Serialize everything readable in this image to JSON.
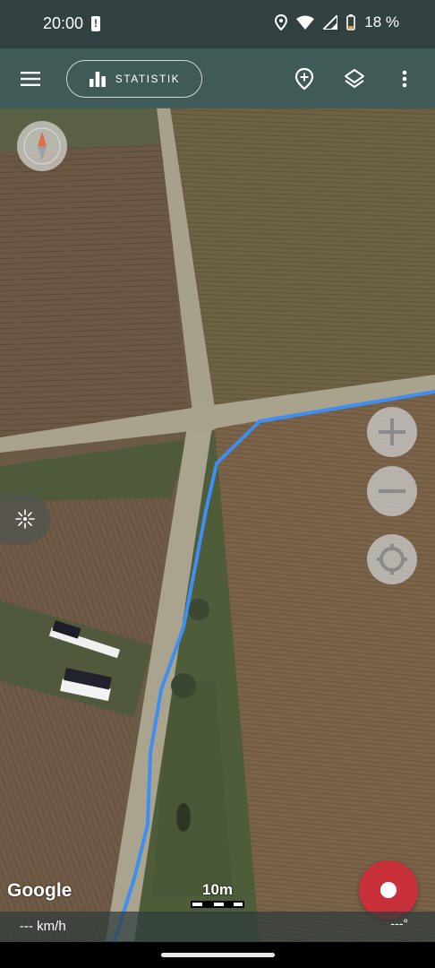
{
  "status_bar": {
    "time": "20:00",
    "alert_glyph": "!",
    "battery_text": "18 %",
    "icons": [
      "location-icon",
      "wifi-icon",
      "signal-icon",
      "battery-icon"
    ]
  },
  "toolbar": {
    "menu_icon": "menu-icon",
    "stat_label": "STATISTIK",
    "stat_icon": "bar-chart-icon",
    "add_marker_icon": "add-location-icon",
    "layers_icon": "layers-icon",
    "overflow_icon": "more-vert-icon"
  },
  "map": {
    "attribution": "Google",
    "scale_label": "10m",
    "track_color": "#3f8ef2"
  },
  "controls": {
    "zoom_in": "plus-icon",
    "zoom_out": "minus-icon",
    "locate": "my-location-icon",
    "compass": "compass-icon",
    "side_tab": "sun-icon"
  },
  "bottom": {
    "speed": "--- km/h",
    "heading": "---°"
  },
  "colors": {
    "status_bg": "#314040",
    "toolbar_bg": "#345a5c",
    "record": "#c8303a"
  }
}
